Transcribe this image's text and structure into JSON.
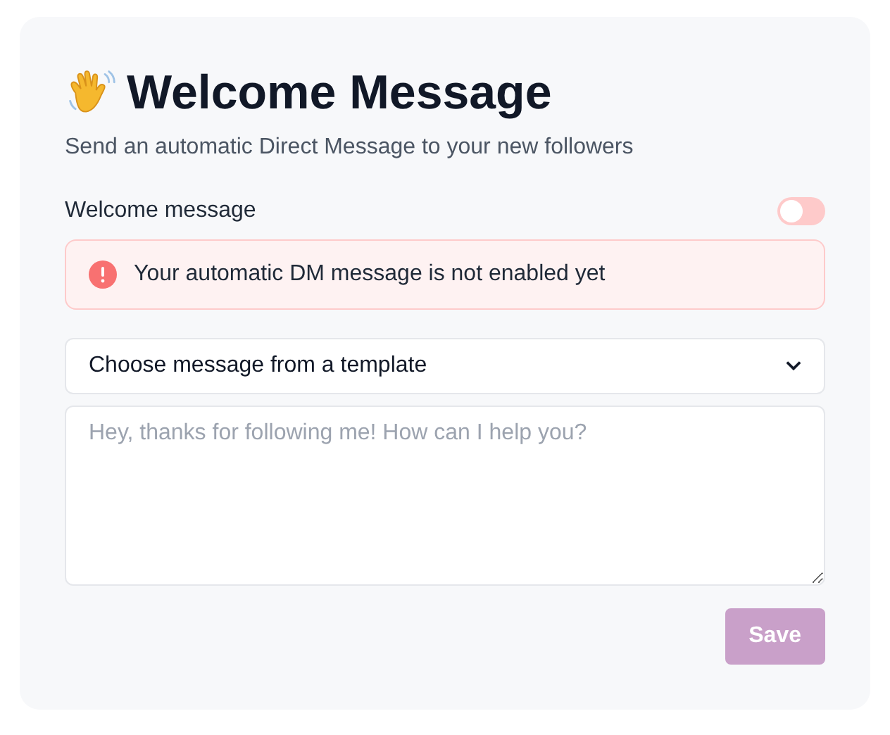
{
  "header": {
    "title": "Welcome Message",
    "subtitle": "Send an automatic Direct Message to your new followers"
  },
  "setting": {
    "label": "Welcome message",
    "on": false
  },
  "alert": {
    "text": "Your automatic DM message is not enabled yet"
  },
  "template_select": {
    "value": "Choose message from a template"
  },
  "message": {
    "placeholder": "Hey, thanks for following me! How can I help you?"
  },
  "save_button": {
    "label": "Save",
    "disabled": true
  }
}
